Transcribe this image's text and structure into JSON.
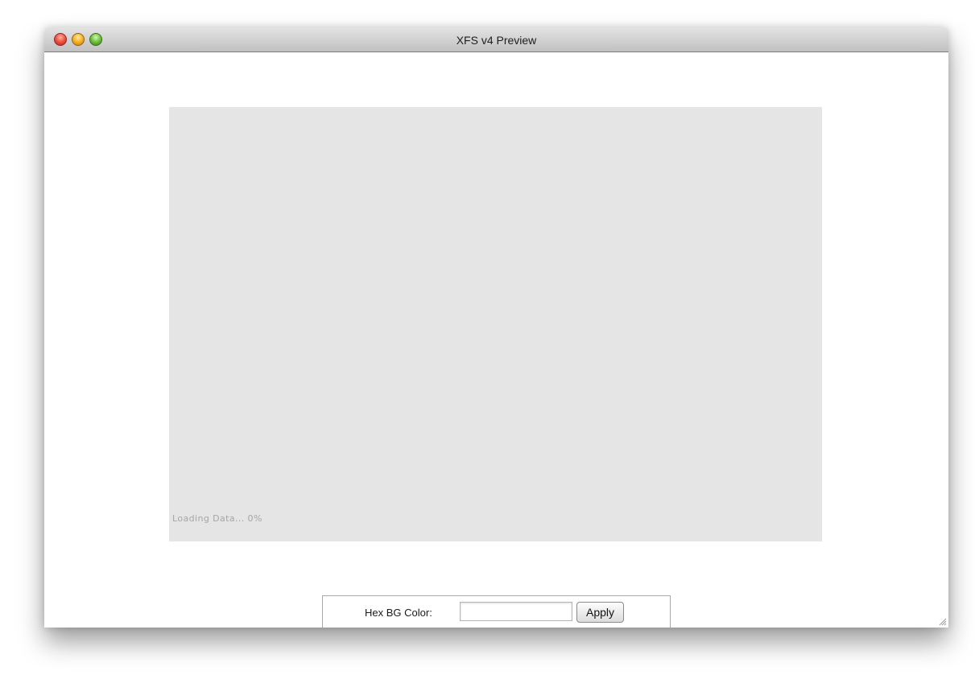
{
  "window": {
    "title": "XFS v4 Preview"
  },
  "stage": {
    "loading_text": "Loading Data... 0%",
    "loading_percent": 0,
    "background_color": "#e5e5e5"
  },
  "controls": {
    "hex_label": "Hex BG Color:",
    "hex_input_value": "",
    "apply_label": "Apply"
  }
}
